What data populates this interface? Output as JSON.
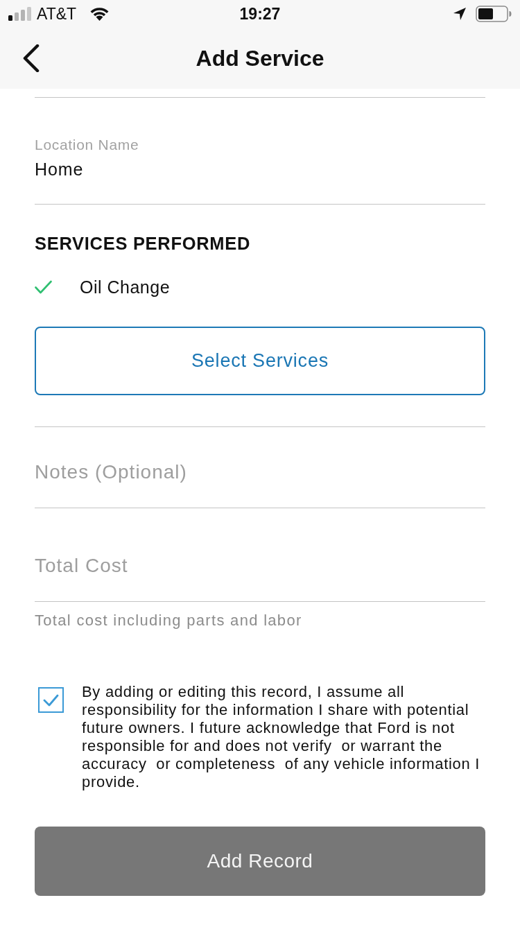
{
  "status_bar": {
    "carrier": "AT&T",
    "time": "19:27"
  },
  "nav_bar": {
    "title": "Add Service"
  },
  "location": {
    "label": "Location Name",
    "value": "Home"
  },
  "services": {
    "heading": "SERVICES PERFORMED",
    "items": [
      {
        "label": "Oil Change",
        "checked": true
      }
    ],
    "button": "Select Services"
  },
  "notes": {
    "placeholder": "Notes (Optional)"
  },
  "total_cost": {
    "placeholder": "Total Cost",
    "helper": "Total cost including parts and labor"
  },
  "agreement": {
    "checked": true,
    "text": "By adding or editing this record, I assume all responsibility for the information I share with potential future owners. I future acknowledge that Ford is not responsible for and does not verify  or warrant the accuracy  or completeness  of any vehicle information I provide."
  },
  "submit": {
    "label": "Add Record",
    "disabled": true
  }
}
